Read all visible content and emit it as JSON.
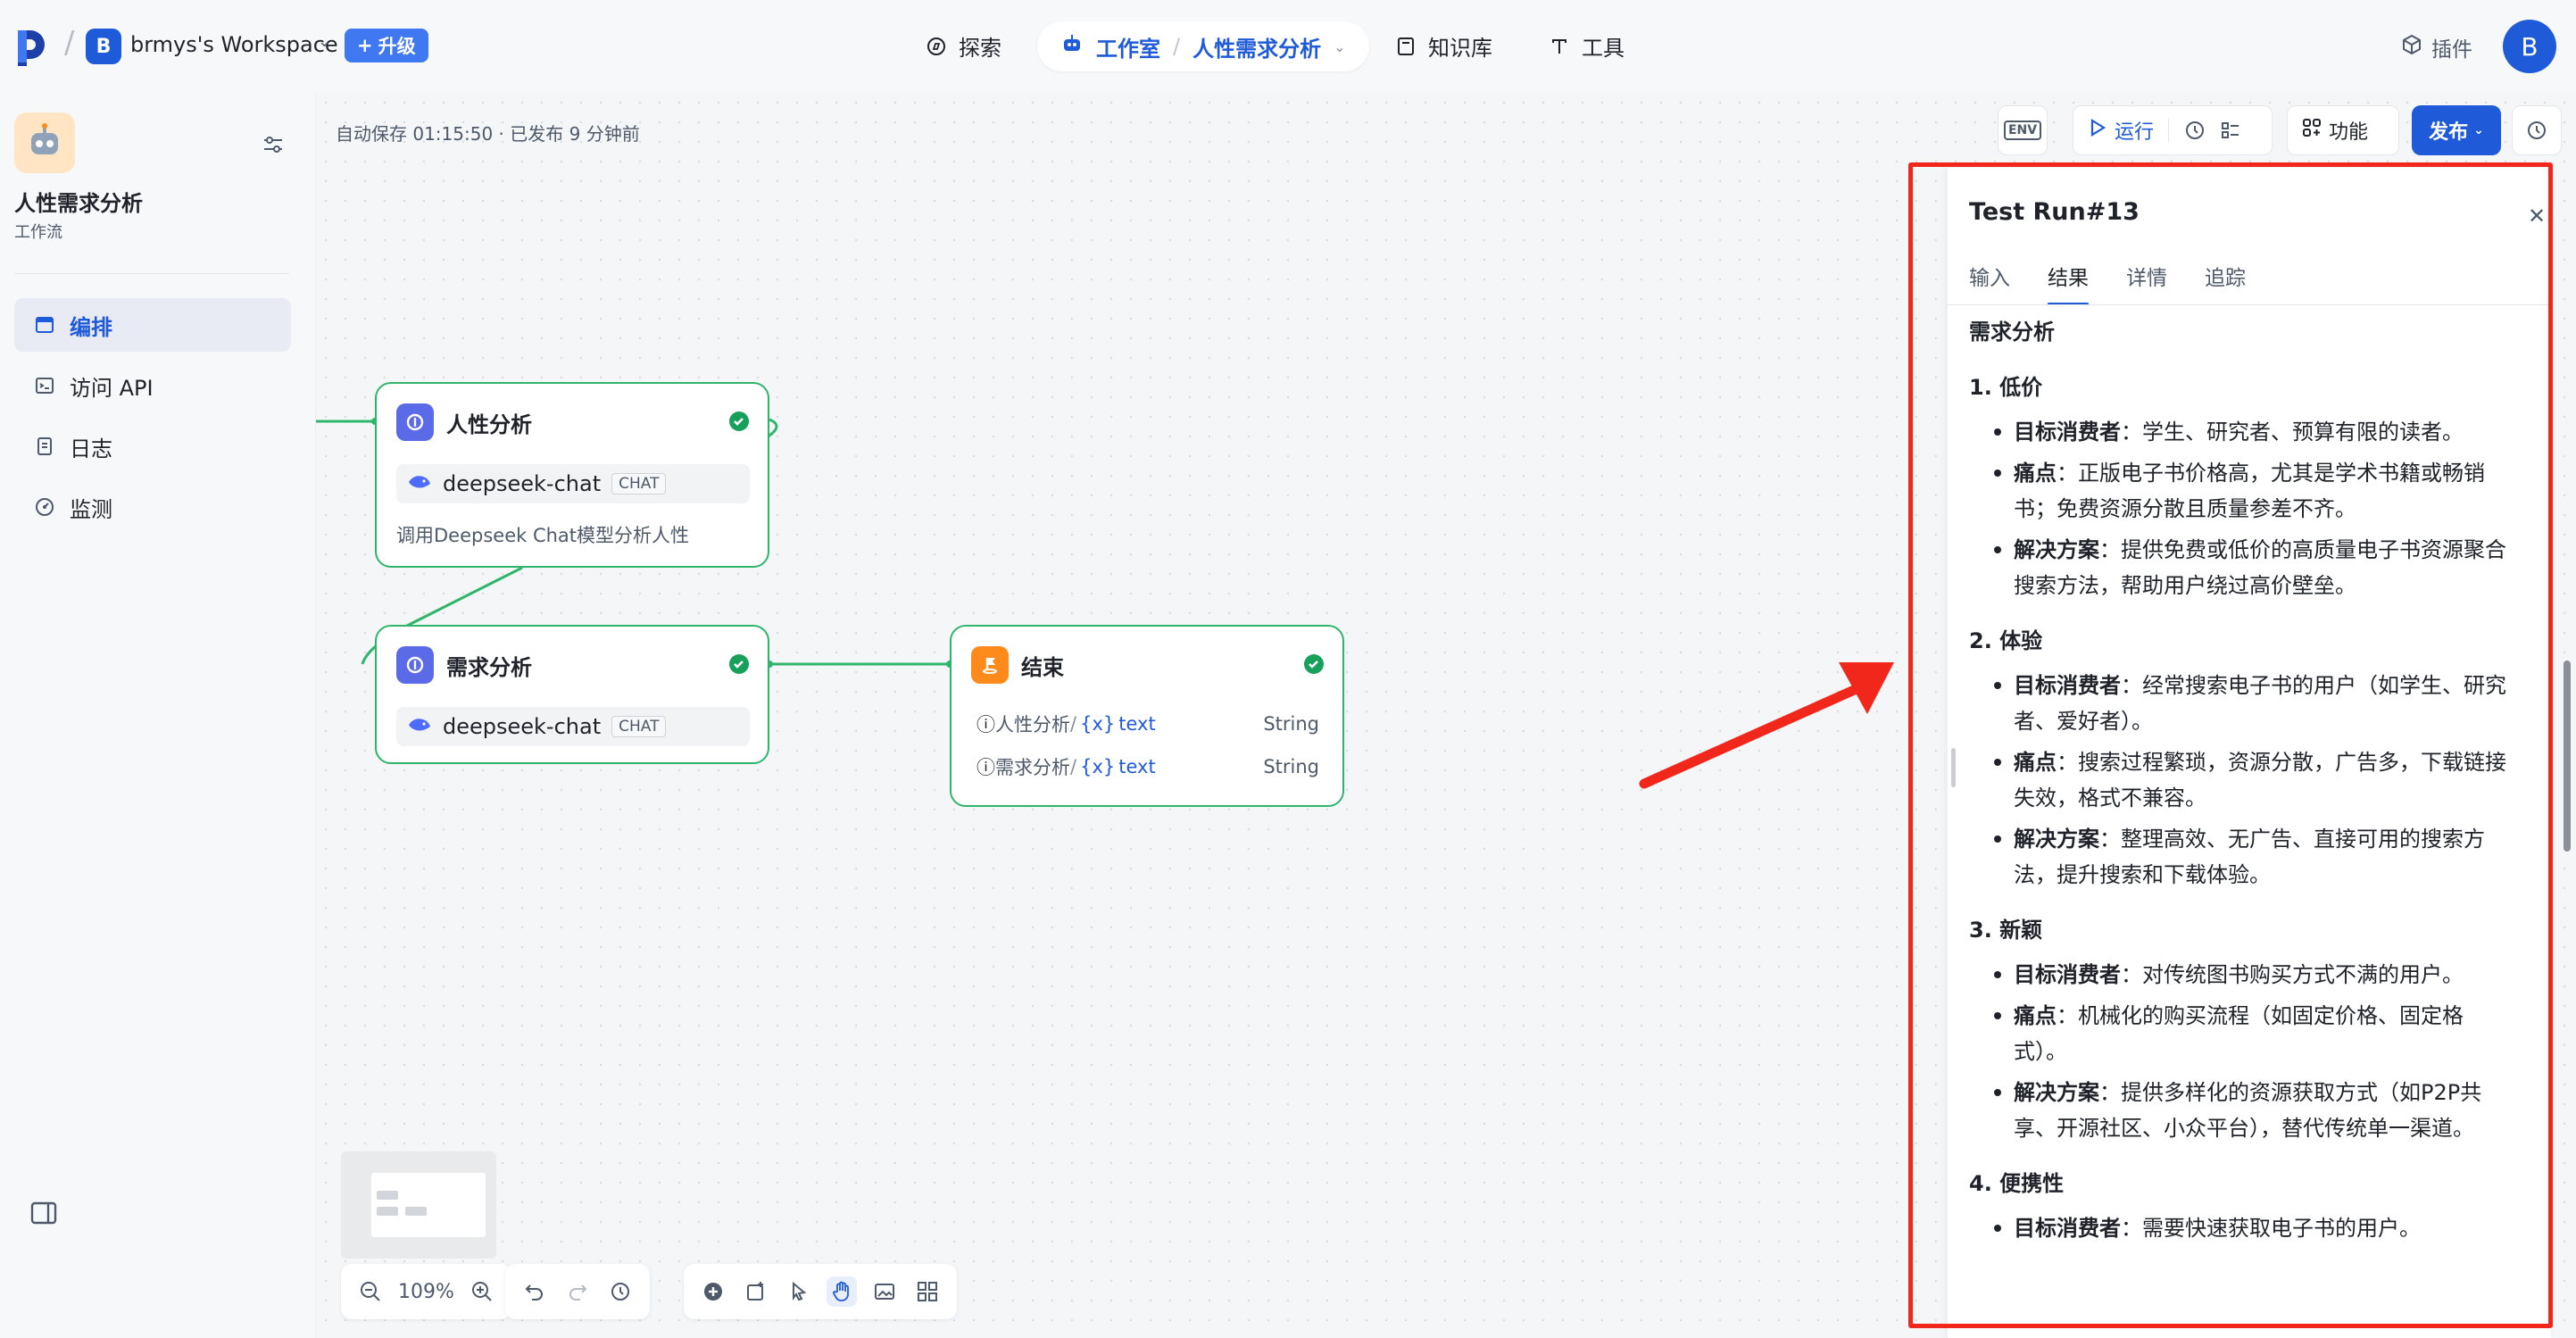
{
  "topbar": {
    "workspace_initial": "B",
    "workspace_name": "brmys's Workspace",
    "upgrade_label": "升级",
    "nav": {
      "explore": "探索",
      "studio": "工作室",
      "project": "人性需求分析",
      "knowledge": "知识库",
      "tools": "工具"
    },
    "plugin_label": "插件",
    "user_initial": "B"
  },
  "sidebar": {
    "app_title": "人性需求分析",
    "app_subtitle": "工作流",
    "items": [
      {
        "label": "编排",
        "icon": "layout-icon",
        "active": true
      },
      {
        "label": "访问 API",
        "icon": "terminal-icon",
        "active": false
      },
      {
        "label": "日志",
        "icon": "log-icon",
        "active": false
      },
      {
        "label": "监测",
        "icon": "monitor-icon",
        "active": false
      }
    ]
  },
  "canvas": {
    "autosave_text": "自动保存 01:15:50 · 已发布 9 分钟前",
    "nodes": {
      "node1": {
        "title": "人性分析",
        "model": "deepseek-chat",
        "tag": "CHAT",
        "desc": "调用Deepseek Chat模型分析人性"
      },
      "node2": {
        "title": "需求分析",
        "model": "deepseek-chat",
        "tag": "CHAT"
      },
      "end": {
        "title": "结束",
        "outputs": [
          {
            "name": "人性分析",
            "var": "text",
            "type": "String"
          },
          {
            "name": "需求分析",
            "var": "text",
            "type": "String"
          }
        ]
      }
    },
    "zoom": "109%"
  },
  "controls": {
    "env_label": "ENV",
    "run_label": "运行",
    "func_label": "功能",
    "publish_label": "发布"
  },
  "panel": {
    "title": "Test Run#13",
    "tabs": [
      "输入",
      "结果",
      "详情",
      "追踪"
    ],
    "active_tab": "结果",
    "heading": "需求分析",
    "sections": [
      {
        "title": "1. 低价",
        "items": [
          {
            "key": "目标消费者",
            "text": "：学生、研究者、预算有限的读者。"
          },
          {
            "key": "痛点",
            "text": "：正版电子书价格高，尤其是学术书籍或畅销书；免费资源分散且质量参差不齐。"
          },
          {
            "key": "解决方案",
            "text": "：提供免费或低价的高质量电子书资源聚合搜索方法，帮助用户绕过高价壁垒。"
          }
        ]
      },
      {
        "title": "2. 体验",
        "items": [
          {
            "key": "目标消费者",
            "text": "：经常搜索电子书的用户（如学生、研究者、爱好者）。"
          },
          {
            "key": "痛点",
            "text": "：搜索过程繁琐，资源分散，广告多，下载链接失效，格式不兼容。"
          },
          {
            "key": "解决方案",
            "text": "：整理高效、无广告、直接可用的搜索方法，提升搜索和下载体验。"
          }
        ]
      },
      {
        "title": "3. 新颖",
        "items": [
          {
            "key": "目标消费者",
            "text": "：对传统图书购买方式不满的用户。"
          },
          {
            "key": "痛点",
            "text": "：机械化的购买流程（如固定价格、固定格式）。"
          },
          {
            "key": "解决方案",
            "text": "：提供多样化的资源获取方式（如P2P共享、开源社区、小众平台），替代传统单一渠道。"
          }
        ]
      },
      {
        "title": "4. 便携性",
        "items": [
          {
            "key": "目标消费者",
            "text": "：需要快速获取电子书的用户。"
          }
        ]
      }
    ]
  },
  "colors": {
    "accent": "#1f5bd8",
    "success": "#2fb56b",
    "annotation": "#f2271c"
  }
}
